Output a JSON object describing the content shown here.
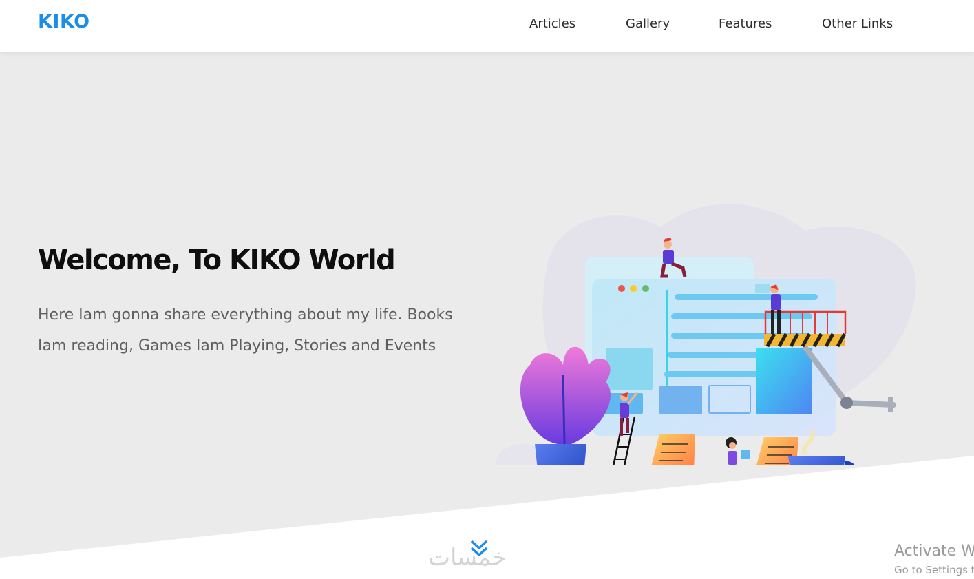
{
  "header": {
    "logo": "KIKO",
    "nav": [
      {
        "label": "Articles"
      },
      {
        "label": "Gallery"
      },
      {
        "label": "Features"
      },
      {
        "label": "Other Links"
      }
    ]
  },
  "hero": {
    "title": "Welcome, To KIKO World",
    "text": "Here Iam gonna share everything about my life. Books Iam reading, Games Iam Playing, Stories and Events"
  },
  "watermark": "خمسات",
  "windows_notice": {
    "title": "Activate Windows",
    "subtitle": "Go to Settings to activate Windows."
  },
  "colors": {
    "accent": "#1a8ee8",
    "hero_bg": "#ebebeb"
  },
  "icons": {
    "scroll": "chevron-double-down-icon"
  }
}
